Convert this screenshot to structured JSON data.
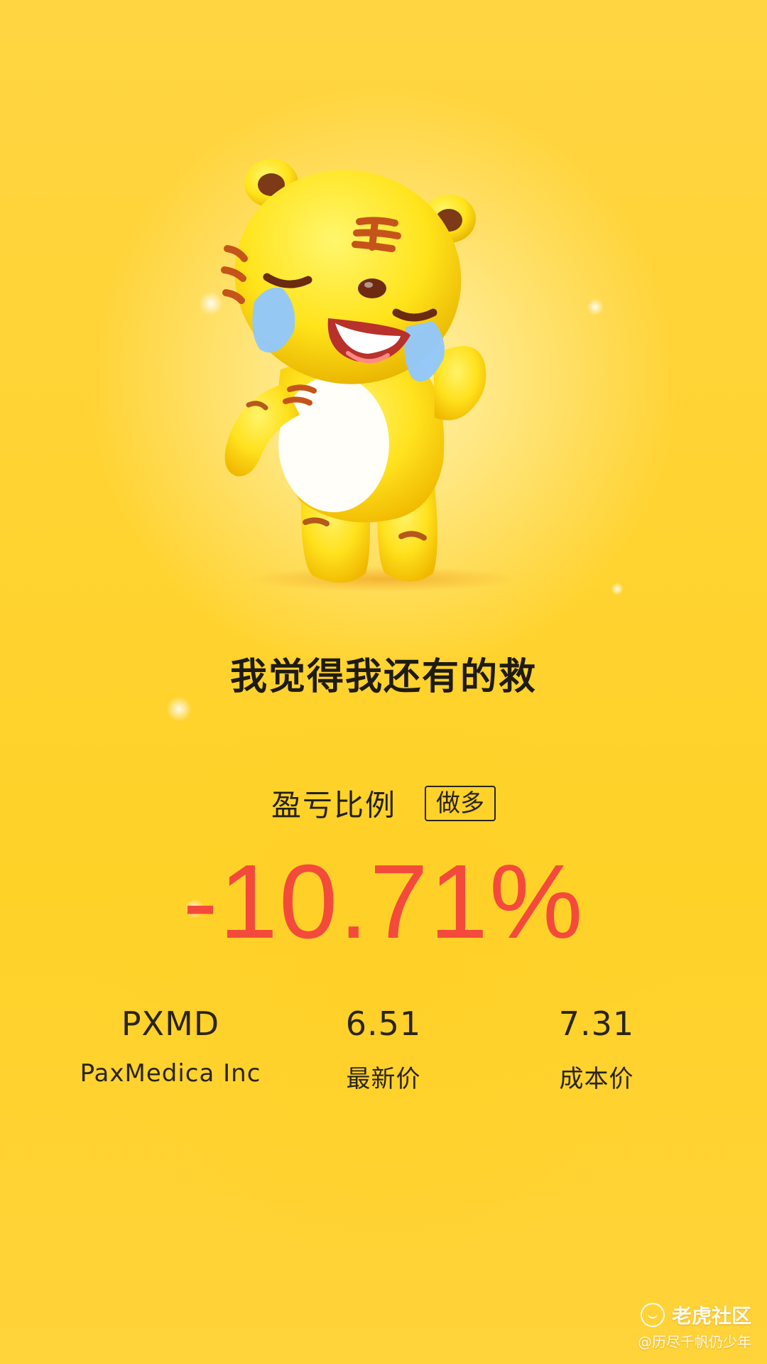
{
  "headline": "我觉得我还有的救",
  "pnl": {
    "label": "盈亏比例",
    "direction": "做多",
    "value": "-10.71%"
  },
  "stats": {
    "ticker": "PXMD",
    "company": "PaxMedica Inc",
    "latest_price": "6.51",
    "latest_price_label": "最新价",
    "cost_price": "7.31",
    "cost_price_label": "成本价"
  },
  "watermark": {
    "brand": "老虎社区",
    "user": "@历尽千帆仍少年"
  },
  "colors": {
    "background": "#ffd332",
    "loss_red": "#f44a3c",
    "text_dark": "#1f1b13"
  },
  "icons": {
    "mascot": "crying-tiger-mascot-icon",
    "brand": "tiger-community-logo-icon"
  }
}
